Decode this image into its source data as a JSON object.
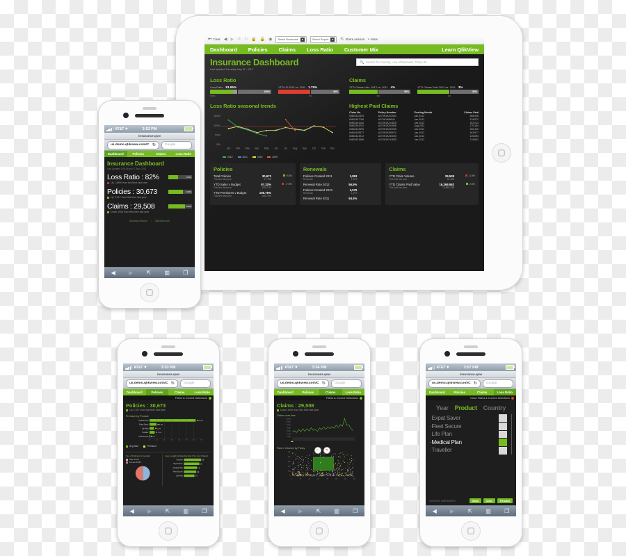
{
  "status_bar": {
    "carrier": "AT&T",
    "battery_icon": "battery-icon",
    "wifi_icon": "wifi-icon"
  },
  "safari": {
    "page_title": "insurance.qvw",
    "url": "us.demo.qlikview.com/C",
    "search_placeholder": "Google",
    "reload_icon": "reload-icon",
    "toolbar": {
      "back_icon": "back-icon",
      "forward_icon": "forward-icon",
      "share_icon": "share-icon",
      "bookmarks_icon": "bookmarks-icon",
      "tabs_icon": "tabs-icon"
    }
  },
  "mobile_nav": [
    "Dashboard",
    "Policies",
    "Claims",
    "Loss Ratio"
  ],
  "filters_bar_label": "Filters & Current Selections",
  "ipad": {
    "toolbar": {
      "clear_label": "Clear",
      "clear_icon": "clear-icon",
      "back_icon": "back-arrow-icon",
      "forward_icon": "forward-arrow-icon",
      "undo_icon": "undo-icon",
      "redo_icon": "redo-icon",
      "lock_icon": "lock-icon",
      "unlock_icon": "unlock-icon",
      "help_icon": "help-icon",
      "bookmark_select": "Select Bookmark",
      "report_select": "Select Report",
      "share_label": "Share session",
      "share_icon": "share-session-icon",
      "more_label": "More"
    },
    "nav": {
      "items": [
        "Dashboard",
        "Policies",
        "Claims",
        "Loss Ratio",
        "Customer Mix"
      ],
      "active": "Dashboard",
      "right_link": "Learn QlikView"
    },
    "header": {
      "title": "Insurance Dashboard",
      "subtitle": "Last Updated Thursday, May 31 , 2012",
      "search_placeholder": "Search for Country, Line of Business, Policy ID...",
      "search_icon": "search-icon"
    },
    "loss_ratio": {
      "section": "Loss Ratio",
      "kpis": [
        {
          "label": "Loss Ratio",
          "value": "81.95%",
          "pct_text": "150%",
          "fill": 38,
          "color": "#76bc21",
          "scale_min": "100%",
          "scale_max": ""
        },
        {
          "label": "YTD LR 2012 vs. 2011",
          "value": "1.79%",
          "pct_text": "50%",
          "fill": 52,
          "color": "#e03c31",
          "scale_min": "0%",
          "scale_max": ""
        }
      ]
    },
    "claims_kpi": {
      "section": "Claims",
      "kpis": [
        {
          "label": "YTD Claims Vols. 2012 vs. 2011",
          "value": "4%",
          "pct_text": "50%",
          "fill": 47,
          "color": "#76bc21",
          "scale_min": "0%",
          "scale_max": ""
        },
        {
          "label": "YTD Claims Paid 2012 vs. 2011",
          "value": "3%",
          "pct_text": "50%",
          "fill": 52,
          "color": "#76bc21",
          "scale_min": "0%",
          "scale_max": ""
        }
      ]
    },
    "trends": {
      "title": "Loss Ratio seasonal trends"
    },
    "highest_paid": {
      "title": "Highest Paid Claims",
      "columns": [
        "Claim No.",
        "Policy Number",
        "Posting Month",
        "Claims Paid"
      ],
      "rows": [
        [
          "IN452422493",
          "AGTW19223904",
          "Jan-2012",
          "288,945"
        ],
        [
          "IN452497756",
          "AGTW1998541",
          "Jan-2012",
          "219,872"
        ],
        [
          "IN452424118",
          "AGTW19214825",
          "Jan-2012",
          "192,014"
        ],
        [
          "IN452304791",
          "AGTW19204958",
          "Aug-2011",
          "179,184"
        ],
        [
          "IN452412699",
          "AGTW19234945",
          "Jan-2012",
          "166,420"
        ],
        [
          "IN452425577",
          "AGTW19305974",
          "Jan-2012",
          "163,877"
        ],
        [
          "IN452424912",
          "AGTW19230090",
          "Jan-2012",
          "145,893"
        ],
        [
          "IN452431586",
          "AGTW19214825",
          "Jan-2012",
          "119,801"
        ]
      ]
    },
    "policies": {
      "title": "Policies",
      "rows": [
        {
          "name": "Total Policies",
          "sub": "This time last year",
          "v1": "30,673",
          "v2": "27,756",
          "chg": "9.5%",
          "dir": "up"
        },
        {
          "name": "YTD Sales v Budget",
          "sub": "This time last year",
          "v1": "97.32%",
          "v2": "105.27%",
          "chg": "-7.9%",
          "dir": "down"
        },
        {
          "name": "YTD Premiums v Budget",
          "sub": "This time last year",
          "v1": "106.75%",
          "v2": "106.75%",
          "chg": "-",
          "dir": "flat"
        }
      ]
    },
    "renewals": {
      "title": "Renewals",
      "rows": [
        {
          "name": "Policies Created 2011",
          "sub": "Renewals",
          "v1": "1,893",
          "v2": "1,072",
          "chg": "",
          "dir": "flat"
        },
        {
          "name": "Renewal Rate 2012",
          "sub": "",
          "v1": "56.5%",
          "v2": "",
          "chg": "",
          "dir": "flat"
        },
        {
          "name": "Policies Created 2010",
          "sub": "Renewals",
          "v1": "1,579",
          "v2": "1,077",
          "chg": "",
          "dir": "flat"
        },
        {
          "name": "Renewal Rate 2011",
          "sub": "",
          "v1": "54.4%",
          "v2": "",
          "chg": "",
          "dir": "flat"
        }
      ]
    },
    "claims_panel": {
      "title": "Claims",
      "rows": [
        {
          "name": "YTD Claim Volume",
          "sub": "This time last year",
          "v1": "29,508",
          "v2": "31,408",
          "chg": "-4.4%",
          "dir": "down"
        },
        {
          "name": "YTD Claims Paid Value",
          "sub": "This time last year",
          "v1": "16,269,562",
          "v2": "15,862,338",
          "chg": "2.5%",
          "dir": "up"
        }
      ]
    }
  },
  "phone_dashboard": {
    "time": "3:53 PM",
    "active_tab": "Dashboard",
    "title": "Insurance Dashboard",
    "subtitle": "Last Updated  3:06:26 pm 07, Nov, 2012",
    "kpis": [
      {
        "label": "Loss Ratio : 82%",
        "delta": "Up 1.68% from this time last year",
        "dir": "up",
        "fill": 40,
        "gauge_text": "150%"
      },
      {
        "label": "Policies : 30,673",
        "delta": "Up 2,917 from this time last year",
        "dir": "down",
        "fill": 62,
        "gauge_text": "100%"
      },
      {
        "label": "Claims : 29,508",
        "delta": "Down 1900 from this time last year",
        "dir": "down",
        "fill": 72,
        "gauge_text": "100%"
      }
    ],
    "footer_links": [
      "Desktop Version",
      "QlikView.com"
    ]
  },
  "phone_policies": {
    "time": "3:53 PM",
    "active_tab": "Policies",
    "title": "Policies : 30,673",
    "delta": "Up 2,917 from this time last year",
    "chart1_title": "Premium by Product",
    "chart2_title": "No. of Policies by Gender",
    "chart3_title": "Avg. Length of Membership (Yrs.) by Product",
    "legend": [
      "Avg Size",
      "Premium"
    ],
    "gender_legend": [
      "Male  30,054",
      "Female  28,864"
    ]
  },
  "phone_claims": {
    "time": "3:54 PM",
    "active_tab": "Claims",
    "title": "Claims : 29,508",
    "delta": "Down 1900 from this time last year",
    "chart1_title": "Claims over time",
    "chart2_title": "Paid v Volumes by Policy",
    "confirm_icon": "check-icon",
    "cancel_icon": "close-icon"
  },
  "phone_filters": {
    "time": "3:57 PM",
    "active_tab": "Loss Ratio",
    "close_label": "Close Filters & Current Selections",
    "close_icon": "close-icon",
    "tabs": [
      "Year",
      "Product",
      "Country"
    ],
    "active_filter_tab": "Product",
    "products": [
      "Expat Saver",
      "Fleet Secure",
      "Life Plan",
      "Medical Plan",
      "Traveller"
    ],
    "selected_product": "Medical Plan",
    "current_selections_label": "Current Selections",
    "buttons": [
      "Back",
      "Clear",
      "Forward"
    ]
  },
  "chart_data": [
    {
      "type": "line",
      "title": "Loss Ratio seasonal trends",
      "xlabel": "",
      "ylabel": "",
      "ylim": [
        0,
        150
      ],
      "yticks": [
        "0%",
        "50%",
        "100%",
        "150%"
      ],
      "categories": [
        "Jan",
        "Feb",
        "Mar",
        "Apr",
        "May",
        "Jun",
        "Jul",
        "Aug",
        "Sep",
        "Oct",
        "Nov",
        "Dec"
      ],
      "legend": [
        "2012",
        "2011",
        "2010",
        "2009"
      ],
      "legend_position": "bottom",
      "grid": false,
      "series": [
        {
          "name": "2012",
          "color": "#3cb44b",
          "values": [
            133,
            96,
            84,
            64,
            53,
            null,
            null,
            null,
            null,
            null,
            null,
            null
          ]
        },
        {
          "name": "2011",
          "color": "#5a7fd6",
          "values": [
            90,
            100,
            86,
            68,
            80,
            78,
            95,
            84,
            78,
            101,
            96,
            66
          ]
        },
        {
          "name": "2010",
          "color": "#e8e04a",
          "values": [
            88,
            100,
            84,
            66,
            78,
            80,
            94,
            86,
            80,
            103,
            95,
            68
          ]
        },
        {
          "name": "2009",
          "color": "#e06040",
          "values": [
            null,
            null,
            null,
            null,
            null,
            null,
            136,
            78,
            null,
            null,
            null,
            null
          ]
        }
      ],
      "reference_line": {
        "value": 100,
        "color": "#c0392b"
      }
    },
    {
      "type": "bar",
      "title": "Premium by Product",
      "orientation": "horizontal",
      "categories": [
        "Medical Plan",
        "Expat Saver",
        "Life Plan",
        "Traveller",
        "Fleet Secure"
      ],
      "values": [
        62.3,
        9.2,
        5.7,
        7.0,
        0.9
      ],
      "value_labels": [
        "62,345",
        "9,234",
        "5,734",
        "7,004",
        "931"
      ],
      "xticks": [
        "0",
        "10",
        "20",
        "30",
        "40",
        "50",
        "60",
        "70"
      ],
      "xlim": [
        0,
        70
      ],
      "ylabel": "",
      "xlabel": ""
    },
    {
      "type": "pie",
      "title": "No. of Policies by Gender",
      "labels": [
        "Male",
        "Female"
      ],
      "values": [
        30054,
        28864
      ],
      "colors": [
        "#8fb5d8",
        "#e0776a"
      ]
    },
    {
      "type": "bar",
      "title": "Avg. Length of Membership (Yrs.) by Product",
      "orientation": "horizontal",
      "categories": [
        "Traveller",
        "Expat Saver",
        "Medical Plan",
        "Fleet Secure",
        "Life Plan"
      ],
      "values": [
        5.6,
        5.0,
        4.2,
        4.0,
        3.4
      ],
      "value_labels": [
        "5.6",
        "5.0",
        "4.2",
        "4.0",
        "3.4"
      ],
      "xlim": [
        0,
        6
      ]
    },
    {
      "type": "line",
      "title": "Claims over time",
      "ylim": [
        0,
        14000
      ],
      "yticks": [
        "14,000",
        "12,000",
        "10,000",
        "8,000",
        "6,000",
        "4,000",
        "2,000"
      ],
      "categories": [],
      "series": [
        {
          "name": "Claims",
          "color": "#5fae2e",
          "values": [
            5600,
            6200,
            5400,
            6900,
            5800,
            7200,
            6100,
            7400,
            6300,
            7800,
            6600,
            7100,
            6000,
            7600,
            6900,
            8100,
            7000,
            8400,
            7300,
            8600,
            7500,
            9200,
            7800,
            9500,
            8200,
            13100,
            8600,
            9000,
            7400,
            6200
          ]
        }
      ]
    },
    {
      "type": "scatter",
      "title": "Paid v Volumes by Policy",
      "xlabel": "",
      "ylabel": "",
      "xticks": [
        "0",
        "20",
        "40",
        "60",
        "80",
        "100",
        "120",
        "140"
      ],
      "yticks": [
        "0",
        "100",
        "200",
        "300",
        "400",
        "500"
      ],
      "selection_box": true
    }
  ]
}
